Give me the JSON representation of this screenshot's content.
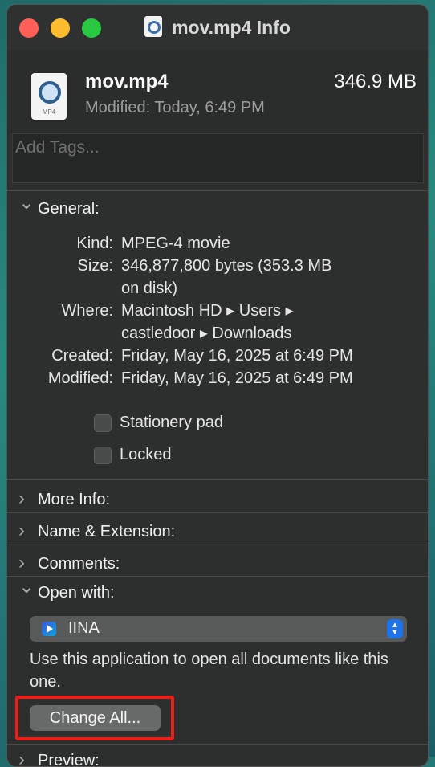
{
  "window": {
    "title": "mov.mp4 Info",
    "file_name": "mov.mp4",
    "file_size": "346.9 MB",
    "modified_summary": "Modified: Today, 6:49 PM",
    "file_icon_ext": "MP4"
  },
  "tags": {
    "placeholder": "Add Tags..."
  },
  "general": {
    "header": "General:",
    "rows": [
      {
        "label": "Kind:",
        "value": "MPEG-4 movie"
      },
      {
        "label": "Size:",
        "value_line1": "346,877,800 bytes (353.3 MB",
        "value_line2": "on disk)"
      },
      {
        "label": "Where:",
        "value_line1": "Macintosh HD ▸ Users ▸",
        "value_line2": "castledoor ▸ Downloads"
      },
      {
        "label": "Created:",
        "value": "Friday, May 16, 2025 at 6:49 PM"
      },
      {
        "label": "Modified:",
        "value": "Friday, May 16, 2025 at 6:49 PM"
      }
    ],
    "stationery_label": "Stationery pad",
    "locked_label": "Locked"
  },
  "sections": {
    "more_info": "More Info:",
    "name_extension": "Name & Extension:",
    "comments": "Comments:",
    "open_with": "Open with:",
    "preview": "Preview:"
  },
  "open_with": {
    "app": "IINA",
    "description": "Use this application to open all documents like this one.",
    "change_all": "Change All..."
  },
  "colors": {
    "highlight": "#e8201c",
    "window_bg": "#2d2f2e",
    "accent": "#1f73e8"
  }
}
